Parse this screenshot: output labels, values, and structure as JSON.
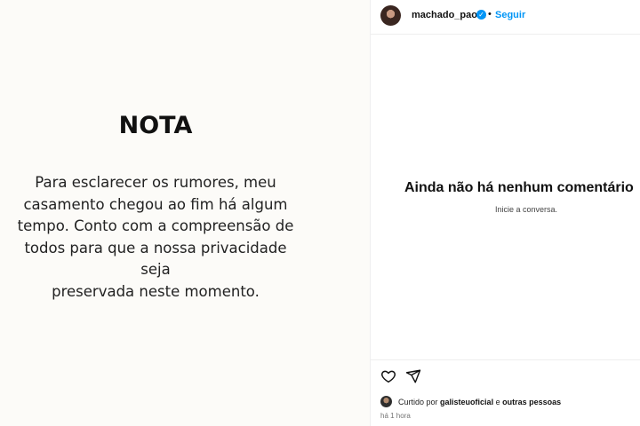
{
  "post": {
    "title": "NOTA",
    "body_lines": [
      "Para esclarecer os rumores, meu",
      "casamento chegou ao fim há algum",
      "tempo.  Conto com a compreensão de",
      "todos para que a nossa privacidade seja",
      "preservada neste momento."
    ]
  },
  "header": {
    "username": "machado_paola",
    "separator": "•",
    "follow_label": "Seguir",
    "verified_icon": "verified-badge-icon"
  },
  "comments": {
    "empty_title": "Ainda não há nenhum comentário",
    "empty_subtitle": "Inicie a conversa."
  },
  "actions": {
    "like_icon": "heart-icon",
    "share_icon": "send-icon"
  },
  "likes": {
    "prefix": "Curtido por",
    "user": "galisteuoficial",
    "conjunction": "e",
    "others": "outras pessoas"
  },
  "timestamp": "há 1 hora",
  "colors": {
    "accent": "#0095f6",
    "image_bg": "#fcfbf8"
  }
}
